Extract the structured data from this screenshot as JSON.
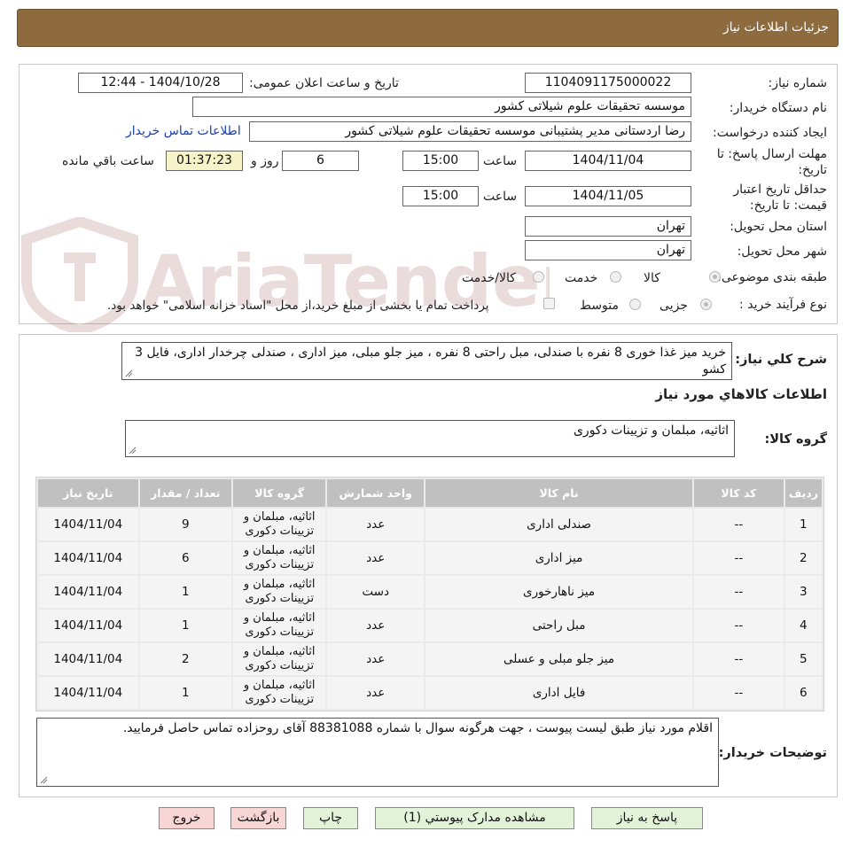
{
  "header": {
    "title": "جزئیات اطلاعات نیاز"
  },
  "form": {
    "need_number_label": "شماره نیاز:",
    "need_number": "1104091175000022",
    "announce_label": "تاریخ و ساعت اعلان عمومی:",
    "announce_value": "1404/10/28 - 12:44",
    "buyer_org_label": "نام دستگاه خریدار:",
    "buyer_org": "موسسه تحقیقات علوم شیلاتی کشور",
    "requester_label": "ایجاد کننده درخواست:",
    "requester": "رضا  اردستانی مدیر پشتیبانی موسسه تحقیقات علوم شیلاتی کشور",
    "contact_link": "اطلاعات تماس خریدار",
    "deadline_label_1": "مهلت ارسال پاسخ: تا",
    "deadline_label_2": "تاریخ:",
    "deadline_date": "1404/11/04",
    "time_label": "ساعت",
    "deadline_time": "15:00",
    "days": "6",
    "days_label": "روز و",
    "remaining": "01:37:23",
    "remaining_label": "ساعت باقي مانده",
    "validity_label_1": "حداقل تاریخ اعتبار",
    "validity_label_2": "قیمت: تا تاریخ:",
    "validity_date": "1404/11/05",
    "validity_time": "15:00",
    "province_label": "استان محل تحویل:",
    "province": "تهران",
    "city_label": "شهر محل تحویل:",
    "city": "تهران",
    "category_label": "طبقه بندی موضوعی:",
    "category_options": [
      "کالا",
      "خدمت",
      "کالا/خدمت"
    ],
    "category_selected": "کالا",
    "process_label": "نوع فرآیند خرید :",
    "process_options": [
      "جزیی",
      "متوسط"
    ],
    "process_selected": "جزیی",
    "treasury_note": "پرداخت تمام یا بخشی از مبلغ خرید،از محل \"اسناد خزانه اسلامی\" خواهد بود."
  },
  "details": {
    "summary_label": "شرح کلي نياز:",
    "summary": "خرید میز غذا خوری 8 نفره با صندلی، مبل راحتی 8 نفره ، میز جلو مبلی، میز اداری ، صندلی چرخدار اداری، فایل 3 کشو",
    "goods_info_title": "اطلاعات کالاهاي مورد نياز",
    "goods_group_label": "گروه کالا:",
    "goods_group": "اثاثیه، مبلمان و تزیینات دکوری"
  },
  "table": {
    "headers": [
      "ردیف",
      "کد کالا",
      "نام کالا",
      "واحد شمارش",
      "گروه کالا",
      "تعداد / مقدار",
      "تاریخ نیاز"
    ],
    "rows": [
      [
        "1",
        "--",
        "صندلی اداری",
        "عدد",
        "اثاثیه، مبلمان و تزیینات دکوری",
        "9",
        "1404/11/04"
      ],
      [
        "2",
        "--",
        "میز اداری",
        "عدد",
        "اثاثیه، مبلمان و تزیینات دکوری",
        "6",
        "1404/11/04"
      ],
      [
        "3",
        "--",
        "میز ناهارخوری",
        "دست",
        "اثاثیه، مبلمان و تزیینات دکوری",
        "1",
        "1404/11/04"
      ],
      [
        "4",
        "--",
        "مبل راحتی",
        "عدد",
        "اثاثیه، مبلمان و تزیینات دکوری",
        "1",
        "1404/11/04"
      ],
      [
        "5",
        "--",
        "میز جلو مبلی و عسلی",
        "عدد",
        "اثاثیه، مبلمان و تزیینات دکوری",
        "2",
        "1404/11/04"
      ],
      [
        "6",
        "--",
        "فایل اداری",
        "عدد",
        "اثاثیه، مبلمان و تزیینات دکوری",
        "1",
        "1404/11/04"
      ]
    ]
  },
  "buyer_notes": {
    "label": "توضیحات خریدار:",
    "text": "اقلام مورد نیاز طبق لیست پیوست ، جهت هرگونه سوال با شماره 88381088 آقای روحزاده تماس حاصل فرمایید."
  },
  "buttons": {
    "reply": "پاسخ به نیاز",
    "attachments": "مشاهده مدارک پیوستي (1)",
    "print": "چاپ",
    "back": "بازگشت",
    "exit": "خروج"
  },
  "watermark": {
    "text": "AriaTender.neT"
  }
}
